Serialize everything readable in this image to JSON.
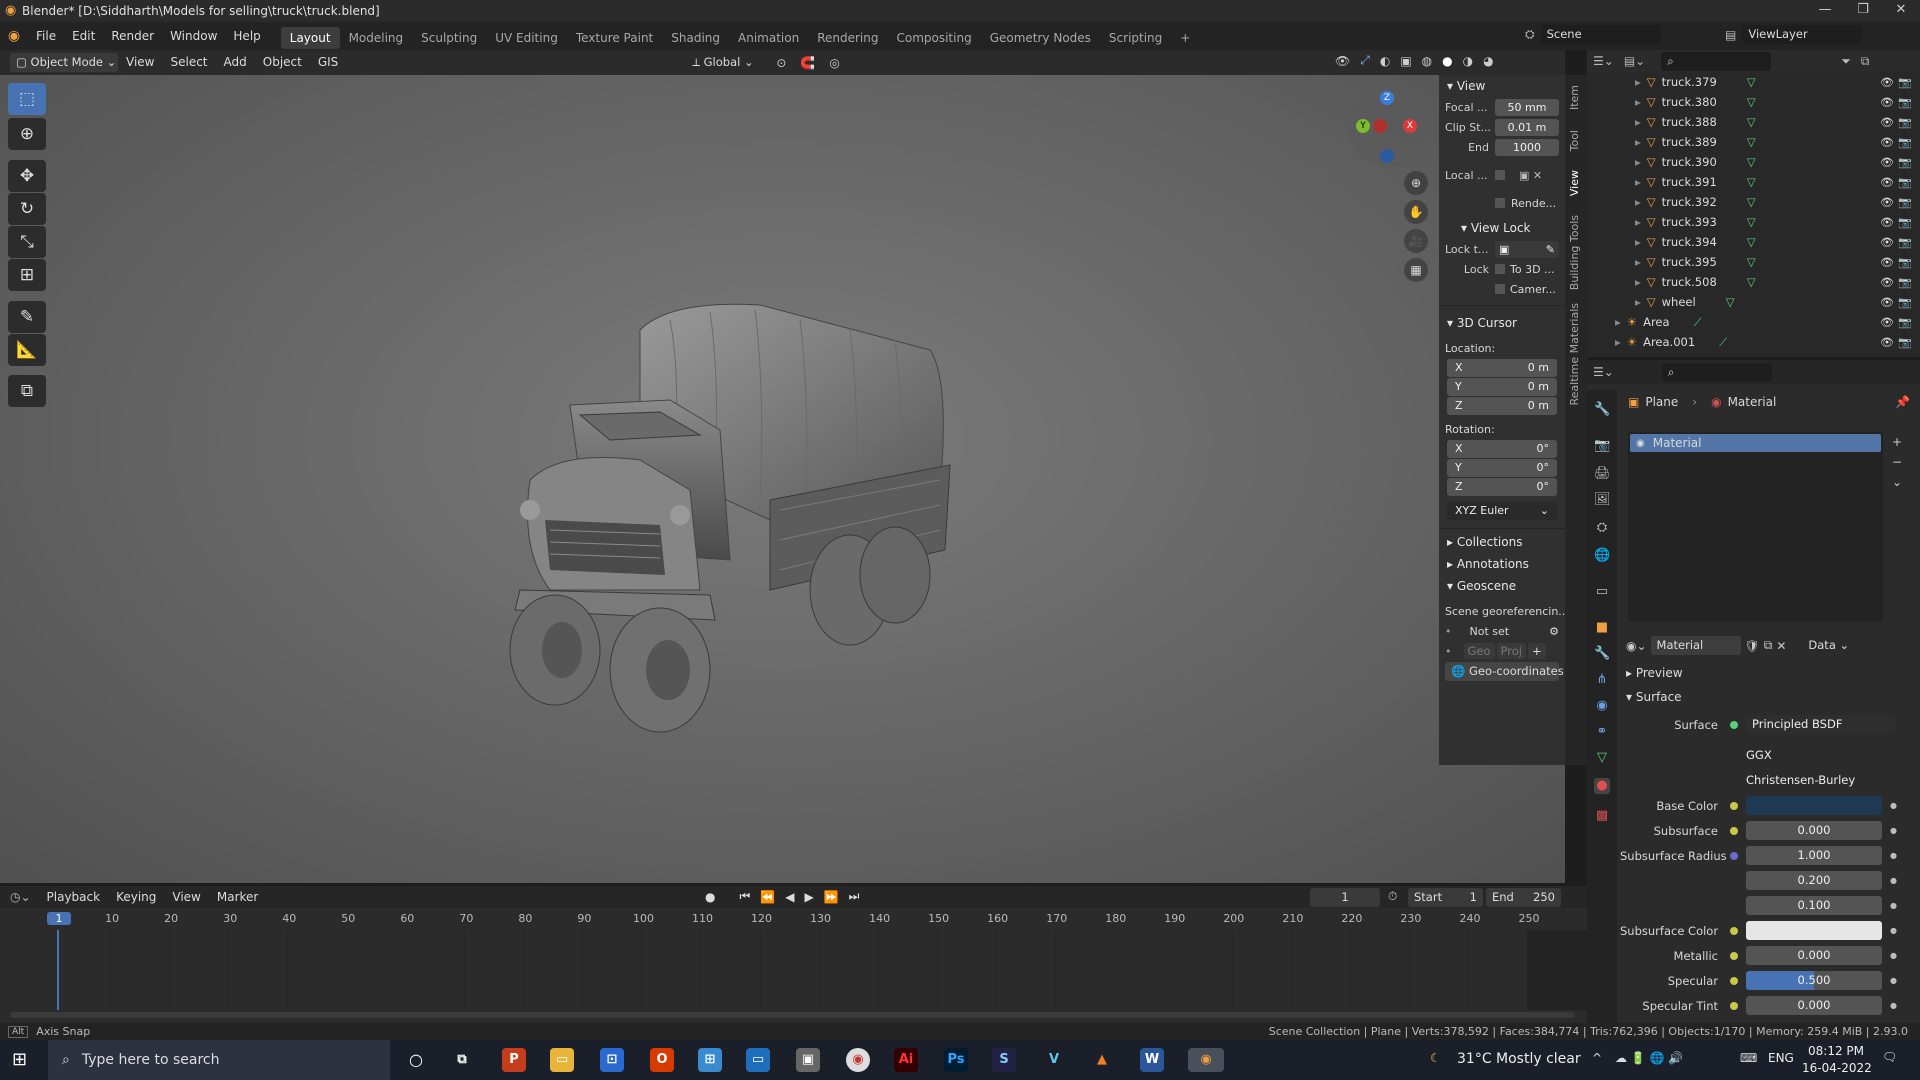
{
  "window": {
    "title": "Blender* [D:\\Siddharth\\Models for selling\\truck\\truck.blend]"
  },
  "menu": [
    "File",
    "Edit",
    "Render",
    "Window",
    "Help"
  ],
  "workspaces": [
    "Layout",
    "Modeling",
    "Sculpting",
    "UV Editing",
    "Texture Paint",
    "Shading",
    "Animation",
    "Rendering",
    "Compositing",
    "Geometry Nodes",
    "Scripting"
  ],
  "active_workspace": "Layout",
  "scene": "Scene",
  "view_layer": "ViewLayer",
  "viewport_header": {
    "mode": "Object Mode",
    "menus": [
      "View",
      "Select",
      "Add",
      "Object",
      "GIS"
    ],
    "orientation": "Global"
  },
  "npanel": {
    "view_title": "View",
    "focal_label": "Focal ...",
    "focal": "50 mm",
    "clip_start_label": "Clip St...",
    "clip_start": "0.01 m",
    "end_label": "End",
    "clip_end": "1000",
    "local_label": "Local ...",
    "render_label": "Rende...",
    "view_lock_title": "View Lock",
    "lock_to_label": "Lock t...",
    "lock_label": "Lock",
    "to3d_label": "To 3D ...",
    "camera_label": "Camer...",
    "cursor_title": "3D Cursor",
    "location_label": "Location:",
    "rotation_label": "Rotation:",
    "loc": [
      {
        "axis": "X",
        "val": "0 m"
      },
      {
        "axis": "Y",
        "val": "0 m"
      },
      {
        "axis": "Z",
        "val": "0 m"
      }
    ],
    "rot": [
      {
        "axis": "X",
        "val": "0°"
      },
      {
        "axis": "Y",
        "val": "0°"
      },
      {
        "axis": "Z",
        "val": "0°"
      }
    ],
    "rot_mode": "XYZ Euler",
    "collections": "Collections",
    "annotations": "Annotations",
    "geoscene": "Geoscene",
    "scene_geo": "Scene georeferencin...",
    "not_set": "Not set",
    "geo": "Geo",
    "proj": "Proj",
    "geo_coordinates": "Geo-coordinates"
  },
  "ntabs": [
    "Item",
    "Tool",
    "View",
    "Building Tools",
    "Realtime Materials"
  ],
  "outliner": {
    "items": [
      {
        "name": "truck.379"
      },
      {
        "name": "truck.380"
      },
      {
        "name": "truck.388"
      },
      {
        "name": "truck.389"
      },
      {
        "name": "truck.390"
      },
      {
        "name": "truck.391"
      },
      {
        "name": "truck.392"
      },
      {
        "name": "truck.393"
      },
      {
        "name": "truck.394"
      },
      {
        "name": "truck.395"
      },
      {
        "name": "truck.508"
      },
      {
        "name": "wheel"
      },
      {
        "name": "Area"
      },
      {
        "name": "Area.001"
      }
    ]
  },
  "properties": {
    "breadcrumb_obj": "Plane",
    "breadcrumb_mat": "Material",
    "slot": "Material",
    "material_name": "Material",
    "link": "Data",
    "preview": "Preview",
    "surface_section": "Surface",
    "surface_label": "Surface",
    "surface_shader": "Principled BSDF",
    "distribution": "GGX",
    "sss_method": "Christensen-Burley",
    "rows": [
      {
        "label": "Base Color",
        "value": "",
        "kind": "color",
        "color": "#1e3a52"
      },
      {
        "label": "Subsurface",
        "value": "0.000",
        "kind": "num"
      },
      {
        "label": "Subsurface Radius",
        "value": "1.000",
        "kind": "num"
      },
      {
        "label": "",
        "value": "0.200",
        "kind": "num"
      },
      {
        "label": "",
        "value": "0.100",
        "kind": "num"
      },
      {
        "label": "Subsurface Color",
        "value": "",
        "kind": "color",
        "color": "#e6e6e6"
      },
      {
        "label": "Metallic",
        "value": "0.000",
        "kind": "num"
      },
      {
        "label": "Specular",
        "value": "0.500",
        "kind": "bar",
        "fill": 0.5
      },
      {
        "label": "Specular Tint",
        "value": "0.000",
        "kind": "num"
      }
    ]
  },
  "timeline": {
    "menus": [
      "Playback",
      "Keying",
      "View",
      "Marker"
    ],
    "current_frame": "1",
    "start_label": "Start",
    "start": "1",
    "end_label": "End",
    "end": "250",
    "ticks": [
      "1",
      "10",
      "20",
      "30",
      "40",
      "50",
      "60",
      "70",
      "80",
      "90",
      "100",
      "110",
      "120",
      "130",
      "140",
      "150",
      "160",
      "170",
      "180",
      "190",
      "200",
      "210",
      "220",
      "230",
      "240",
      "250"
    ]
  },
  "status": {
    "left": "Axis Snap",
    "alt": "Alt",
    "right": "Scene Collection | Plane | Verts:378,592 | Faces:384,774 | Tris:762,396 | Objects:1/170 | Memory: 259.4 MiB | 2.93.0"
  },
  "taskbar": {
    "search": "Type here to search",
    "weather": "31°C  Mostly clear",
    "lang": "ENG",
    "time": "08:12 PM",
    "date": "16-04-2022"
  }
}
